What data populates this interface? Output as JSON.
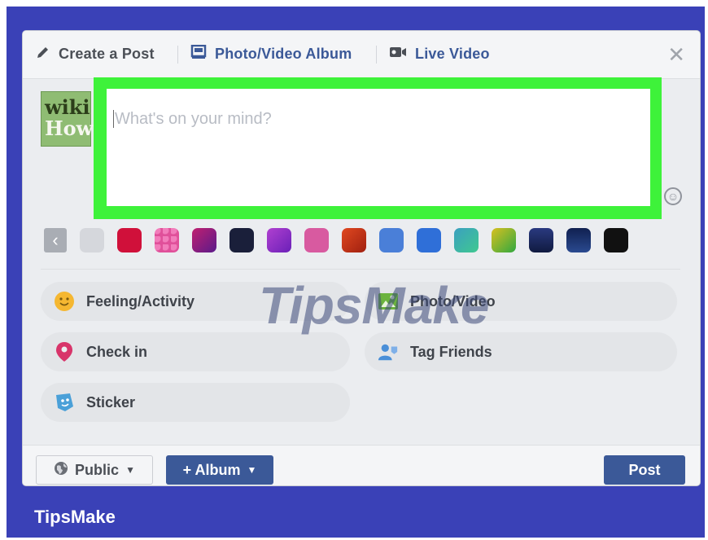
{
  "header": {
    "tabs": [
      {
        "label": "Create a Post",
        "icon": "pencil-icon"
      },
      {
        "label": "Photo/Video Album",
        "icon": "album-icon"
      },
      {
        "label": "Live Video",
        "icon": "video-camera-icon"
      }
    ],
    "close_icon": "close-icon"
  },
  "avatar": {
    "line1": "wiki",
    "line2": "How"
  },
  "composer": {
    "placeholder": "What's on your mind?",
    "highlight_color": "#3ef23a"
  },
  "backgrounds": {
    "colors": [
      "#d5d7dc",
      "#d0103a",
      "#e0509a",
      "#8a1a7a",
      "#1a1f3a",
      "#8b2fc9",
      "#d85aa0",
      "#c0301a",
      "#4a7fd8",
      "#2f6fd8",
      "#3ab7a5",
      "#5bbf3a",
      "#1a2560",
      "#102050",
      "#111111"
    ]
  },
  "actions": [
    {
      "label": "Feeling/Activity",
      "icon": "smiley-icon"
    },
    {
      "label": "Photo/Video",
      "icon": "photo-icon"
    },
    {
      "label": "Check in",
      "icon": "location-pin-icon"
    },
    {
      "label": "Tag Friends",
      "icon": "tag-friends-icon"
    },
    {
      "label": "Sticker",
      "icon": "sticker-icon"
    }
  ],
  "footer": {
    "public_label": "Public",
    "album_label": "+ Album",
    "post_label": "Post"
  },
  "watermark": "TipsMake",
  "brand": "TipsMake",
  "colors": {
    "frame": "#3a41b7",
    "accent": "#3b5998"
  }
}
